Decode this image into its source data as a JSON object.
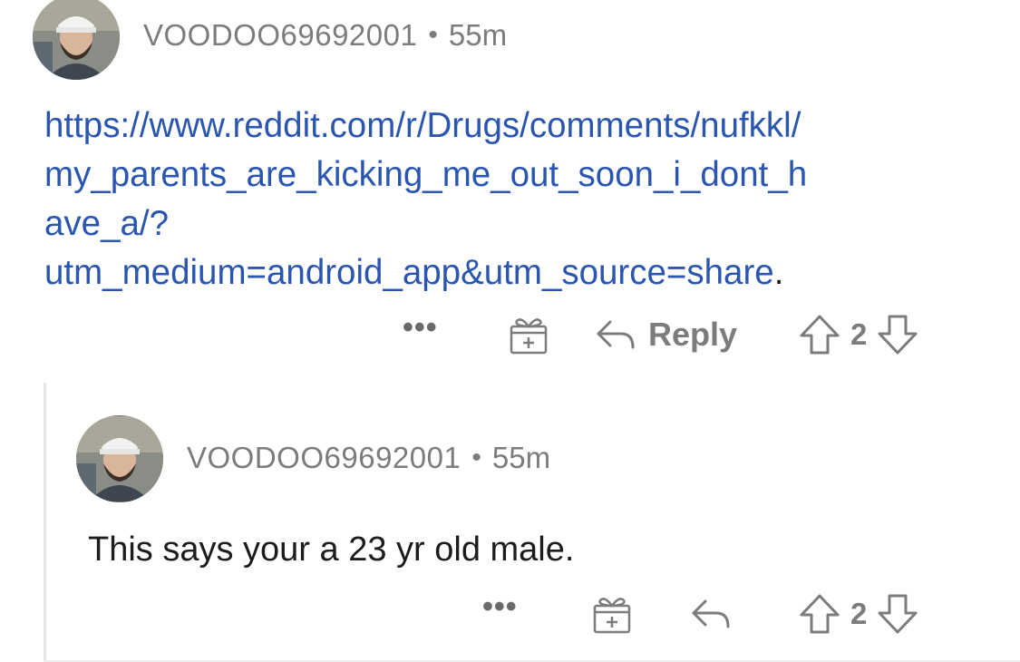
{
  "comments": [
    {
      "username": "VOODOO69692001",
      "separator": "•",
      "time": "55m",
      "link_lines": [
        "https://www.reddit.com/r/Drugs/comments/nufkkl/",
        "my_parents_are_kicking_me_out_soon_i_dont_h",
        "ave_a/?",
        "utm_medium=android_app&utm_source=share"
      ],
      "link_trailing": ".",
      "actions": {
        "more": "•••",
        "reply_label": "Reply",
        "score": "2"
      }
    },
    {
      "username": "VOODOO69692001",
      "separator": "•",
      "time": "55m",
      "text": "This says your a 23 yr old male.",
      "actions": {
        "more": "•••",
        "score": "2"
      }
    }
  ],
  "icons": {
    "more": "more-options-icon",
    "award": "gift-award-icon",
    "reply": "reply-arrow-icon",
    "upvote": "upvote-arrow-icon",
    "downvote": "downvote-arrow-icon"
  },
  "colors": {
    "link": "#2a55b0",
    "meta": "#7c7c7c",
    "text": "#1c1c1c"
  }
}
